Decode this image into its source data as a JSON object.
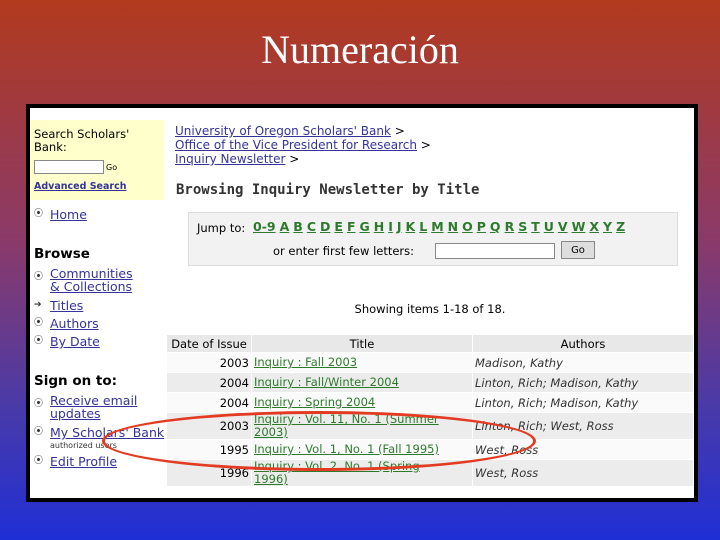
{
  "slide_title": "Numeración",
  "sidebar": {
    "search_label": "Search Scholars' Bank:",
    "go_label": "Go",
    "advanced_search": "Advanced Search",
    "home": "Home",
    "browse_heading": "Browse",
    "communities_1": "Communities",
    "communities_2": "& Collections",
    "titles": "Titles",
    "authors": "Authors",
    "by_date": "By Date",
    "sign_on_heading": "Sign on to:",
    "receive_email_1": "Receive email",
    "receive_email_2": "updates",
    "my_scholars_bank": "My Scholars' Bank",
    "authorized_users": "authorized users",
    "edit_profile": "Edit Profile"
  },
  "breadcrumb": {
    "item1": "University of Oregon Scholars' Bank",
    "item2": "Office of the Vice President for Research",
    "item3": "Inquiry Newsletter",
    "sep": ">"
  },
  "browse": {
    "title": "Browsing Inquiry Newsletter by Title",
    "jump_label": "Jump to:",
    "letters": [
      "0-9",
      "A",
      "B",
      "C",
      "D",
      "E",
      "F",
      "G",
      "H",
      "I",
      "J",
      "K",
      "L",
      "M",
      "N",
      "O",
      "P",
      "Q",
      "R",
      "S",
      "T",
      "U",
      "V",
      "W",
      "X",
      "Y",
      "Z"
    ],
    "enter_label": "or enter first few letters:",
    "go_button": "Go",
    "showing": "Showing items 1-18 of 18."
  },
  "table": {
    "headers": [
      "Date of Issue",
      "Title",
      "Authors"
    ],
    "rows": [
      {
        "date": "2003",
        "title_1": "Inquiry : Fall 2003",
        "title_2": "",
        "authors": "Madison, Kathy"
      },
      {
        "date": "2004",
        "title_1": "Inquiry : Fall/Winter 2004",
        "title_2": "",
        "authors": "Linton, Rich; Madison, Kathy"
      },
      {
        "date": "2004",
        "title_1": "Inquiry : Spring 2004",
        "title_2": "",
        "authors": "Linton, Rich; Madison, Kathy"
      },
      {
        "date": "2003",
        "title_1": "Inquiry : Vol. 11, No. 1 (Summer",
        "title_2": "2003)",
        "authors": "Linton, Rich; West, Ross"
      },
      {
        "date": "1995",
        "title_1": "Inquiry : Vol. 1, No. 1 (Fall 1995)",
        "title_2": "",
        "authors": "West, Ross"
      },
      {
        "date": "1996",
        "title_1": "Inquiry : Vol. 2, No. 1 (Spring",
        "title_2": "1996)",
        "authors": "West, Ross"
      }
    ]
  },
  "colors": {
    "highlight_circle": "#e23b22",
    "link_blue": "#333399",
    "link_green": "#2d7a2d",
    "search_bg": "#ffffcc"
  }
}
